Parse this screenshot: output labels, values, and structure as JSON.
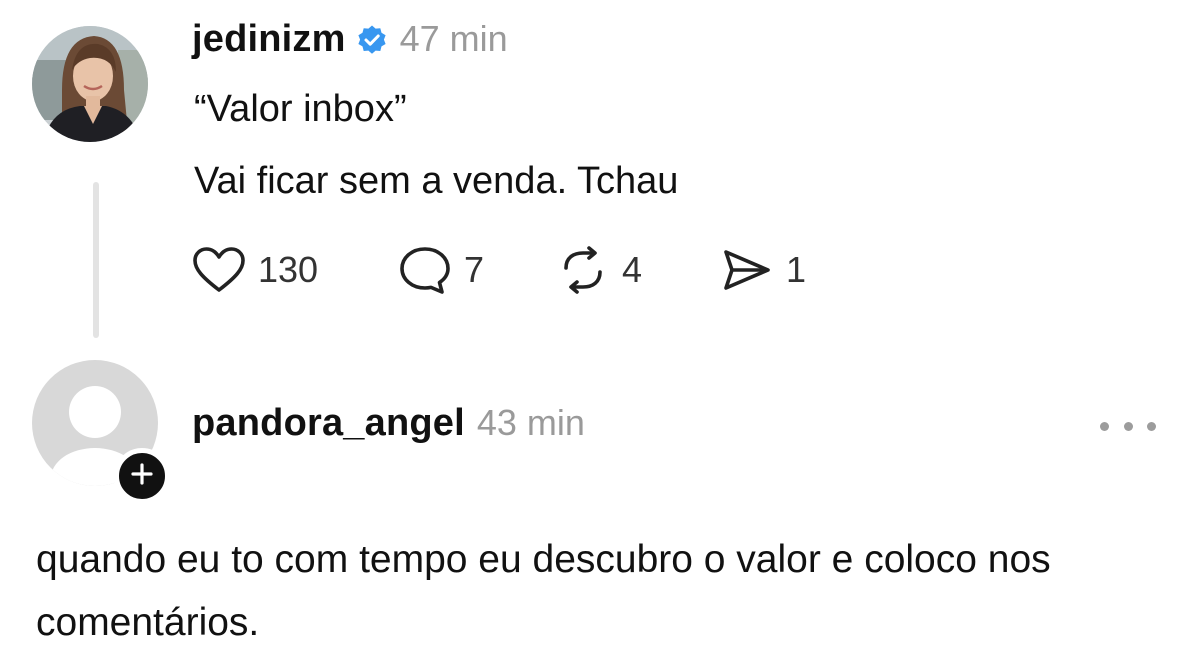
{
  "post": {
    "username": "jedinizm",
    "time": "47 min",
    "lines": [
      "“Valor inbox”",
      "Vai ficar sem a venda. Tchau"
    ],
    "actions": {
      "likes": "130",
      "replies": "7",
      "reposts": "4",
      "shares": "1"
    },
    "verified_icon": "verified-badge-icon",
    "accent_color": "#3897f0"
  },
  "reply": {
    "username": "pandora_angel",
    "time": "43 min",
    "text": "quando eu to com tempo eu descubro o valor e coloco nos comentários."
  }
}
